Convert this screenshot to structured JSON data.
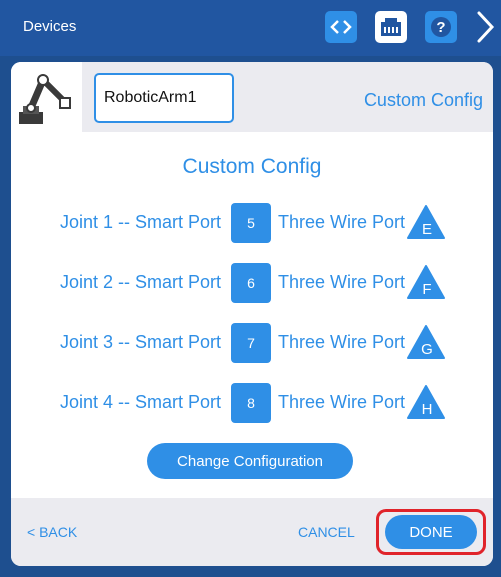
{
  "header": {
    "title": "Devices"
  },
  "toolbar": {
    "code_icon": "code-icon",
    "ports_icon": "ports-icon",
    "help_icon": "help-icon",
    "help_glyph": "?",
    "next_icon": "chevron-right-icon"
  },
  "device": {
    "icon": "robotic-arm-icon",
    "name_value": "RoboticArm1",
    "config_link": "Custom Config"
  },
  "section": {
    "title": "Custom Config"
  },
  "joints": [
    {
      "label": "Joint 1 -- Smart Port",
      "port": "5",
      "wire_label": "Three Wire Port",
      "wire_port": "E"
    },
    {
      "label": "Joint 2 -- Smart Port",
      "port": "6",
      "wire_label": "Three Wire Port",
      "wire_port": "F"
    },
    {
      "label": "Joint 3 -- Smart Port",
      "port": "7",
      "wire_label": "Three Wire Port",
      "wire_port": "G"
    },
    {
      "label": "Joint 4 -- Smart Port",
      "port": "8",
      "wire_label": "Three Wire Port",
      "wire_port": "H"
    }
  ],
  "actions": {
    "change_config": "Change Configuration",
    "back": "< BACK",
    "cancel": "CANCEL",
    "done": "DONE"
  },
  "colors": {
    "accent": "#2f8fe6",
    "topbar": "#2156a1",
    "highlight": "#e0232a"
  }
}
